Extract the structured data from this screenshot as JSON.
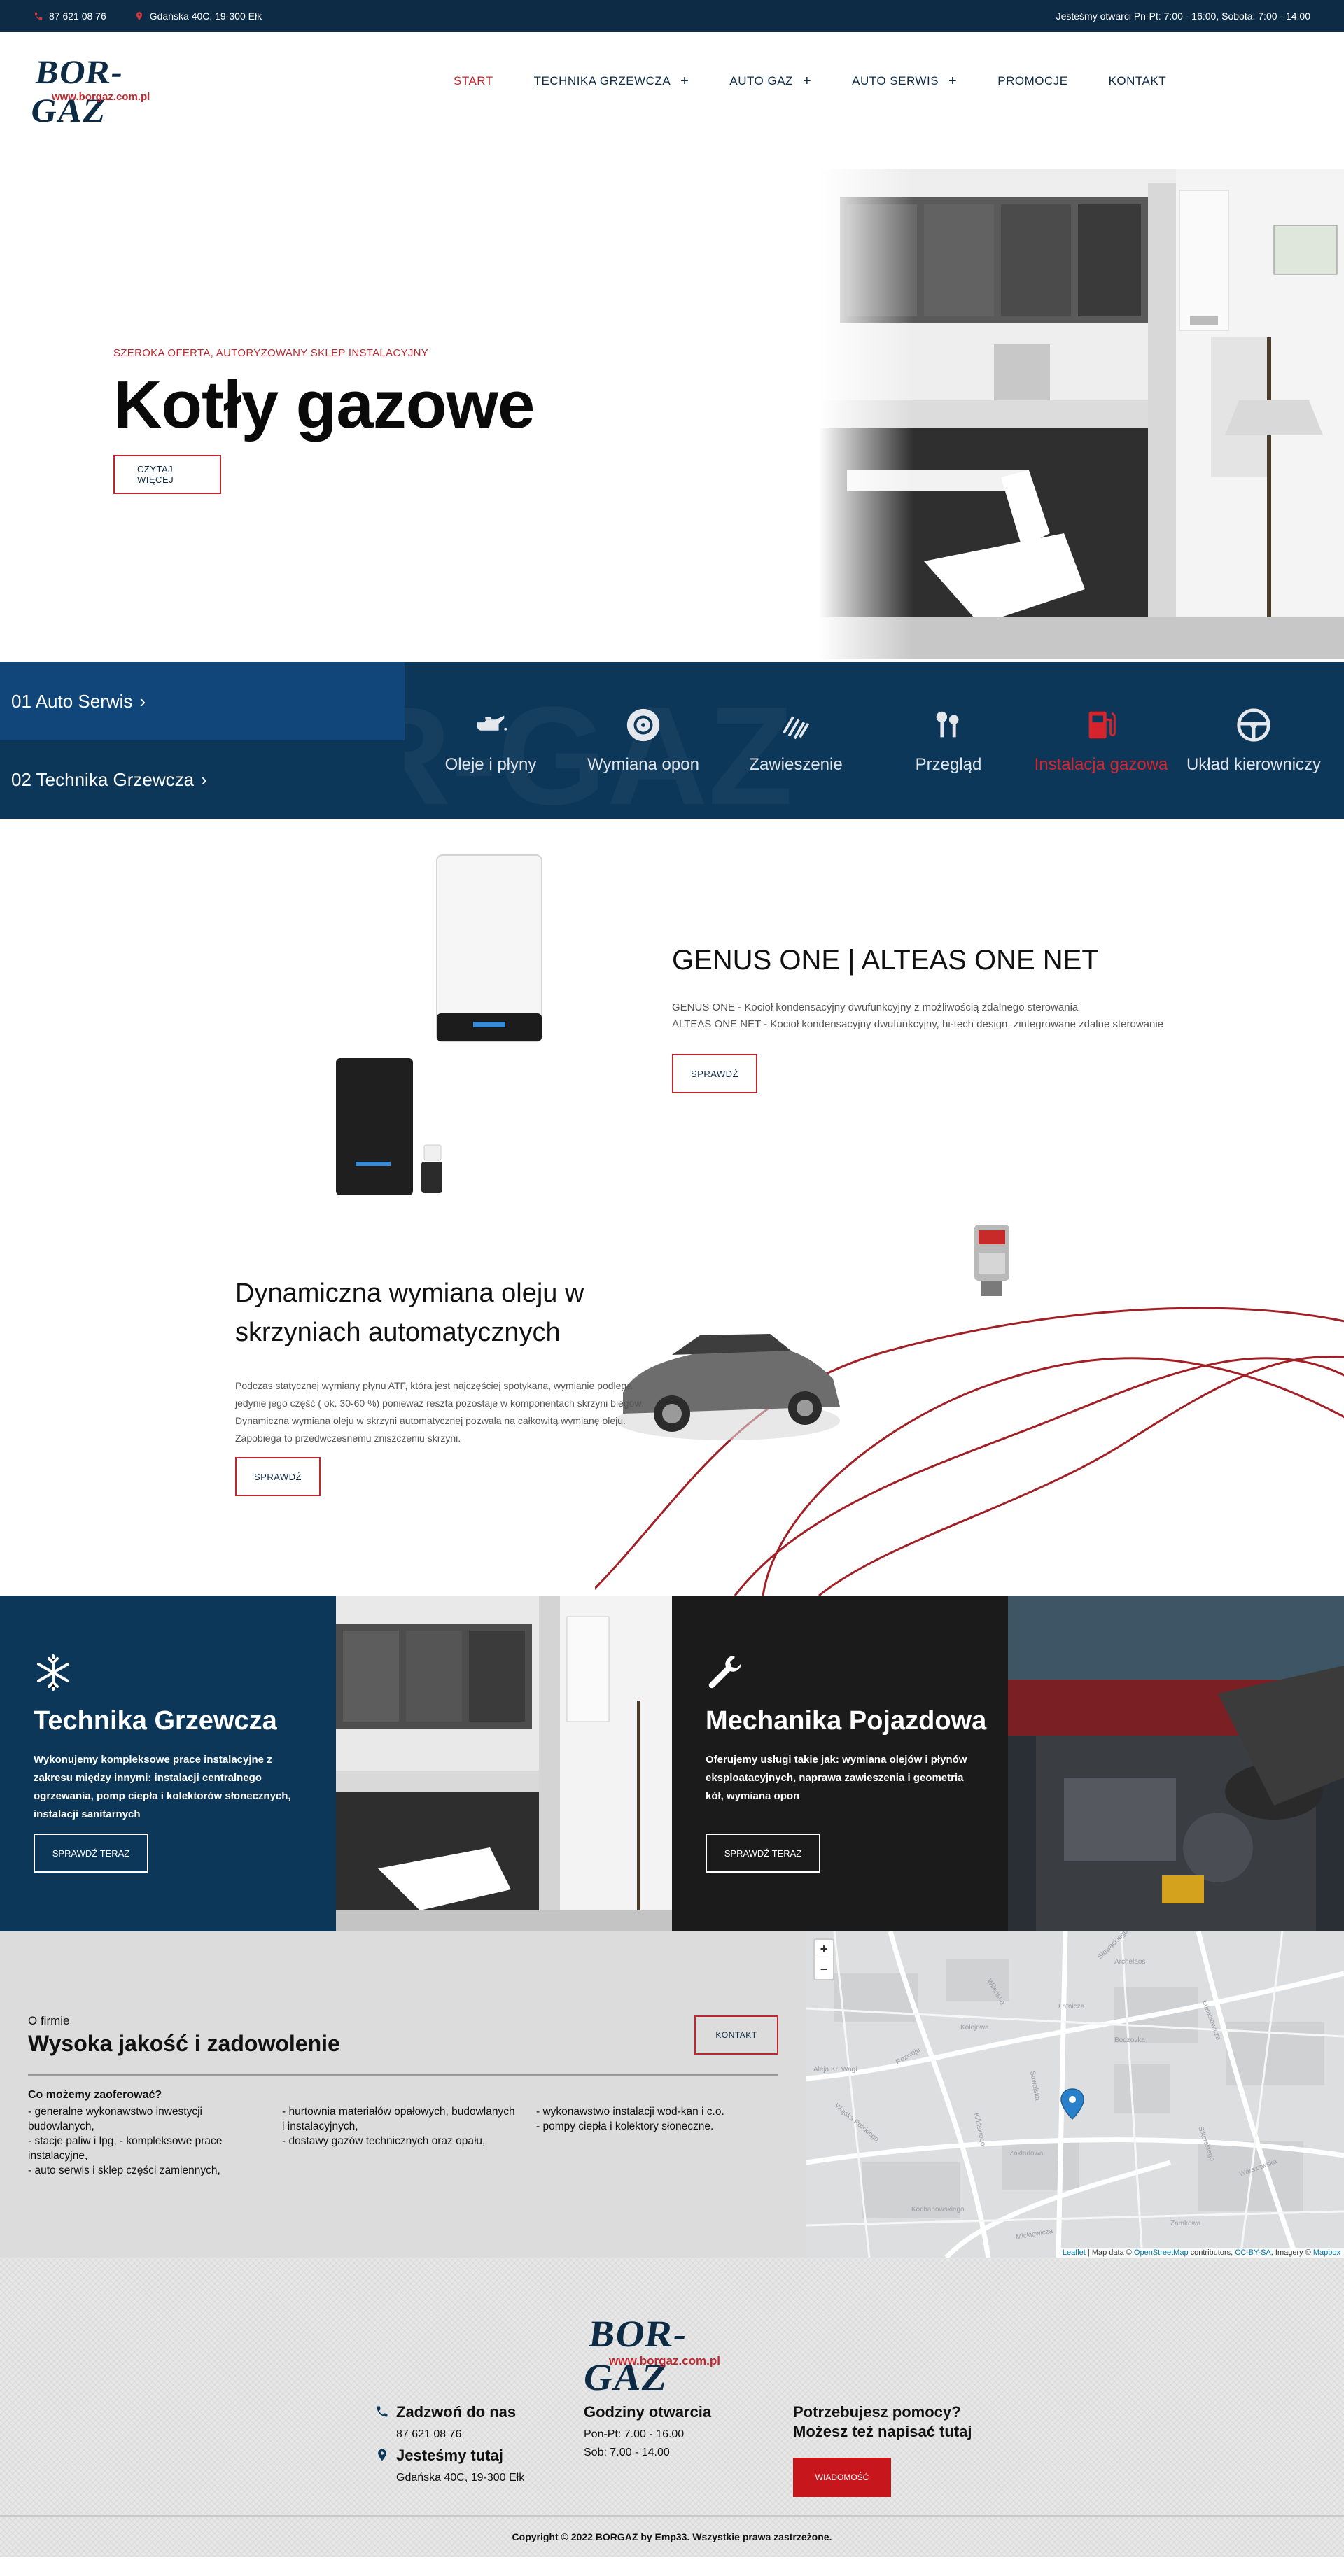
{
  "topbar": {
    "phone": "87 621 08 76",
    "address": "Gdańska 40C, 19-300 Ełk",
    "hours": "Jesteśmy otwarci Pn-Pt: 7:00 - 16:00, Sobota: 7:00 - 14:00"
  },
  "logo": {
    "word": "BOR-GAZ",
    "url": "www.borgaz.com.pl"
  },
  "nav": [
    {
      "label": "START",
      "active": true,
      "has_sub": false
    },
    {
      "label": "TECHNIKA GRZEWCZA",
      "active": false,
      "has_sub": true
    },
    {
      "label": "AUTO GAZ",
      "active": false,
      "has_sub": true
    },
    {
      "label": "AUTO SERWIS",
      "active": false,
      "has_sub": true
    },
    {
      "label": "PROMOCJE",
      "active": false,
      "has_sub": false
    },
    {
      "label": "KONTAKT",
      "active": false,
      "has_sub": false
    }
  ],
  "nav_plus": "+",
  "hero": {
    "overline": "SZEROKA OFERTA, AUTORYZOWANY SKLEP INSTALACYJNY",
    "title": "Kotły gazowe",
    "button": "CZYTAJ WIĘCEJ"
  },
  "service": {
    "tabs": [
      {
        "label": "01 Auto Serwis"
      },
      {
        "label": "02 Technika Grzewcza"
      }
    ],
    "chevron": "›",
    "watermark": "BOR-GAZ",
    "items": [
      {
        "label": "Oleje i płyny",
        "icon": "oil-can-icon"
      },
      {
        "label": "Wymiana opon",
        "icon": "tire-icon"
      },
      {
        "label": "Zawieszenie",
        "icon": "spring-icon"
      },
      {
        "label": "Przegląd",
        "icon": "keys-icon"
      },
      {
        "label": "Instalacja gazowa",
        "icon": "gas-pump-icon"
      },
      {
        "label": "Układ kierowniczy",
        "icon": "steering-wheel-icon"
      }
    ],
    "highlight_color": "#d6242d"
  },
  "product": {
    "title": "GENUS ONE | ALTEAS ONE NET",
    "desc_line1": "GENUS ONE - Kocioł kondensacyjny dwufunkcyjny z możliwością zdalnego sterowania",
    "desc_line2": "ALTEAS ONE NET - Kocioł kondensacyjny dwufunkcyjny, hi-tech design, zintegrowane zdalne sterowanie",
    "button": "SPRAWDŹ"
  },
  "oil": {
    "title": "Dynamiczna wymiana oleju w skrzyniach automatycznych",
    "desc": "Podczas statycznej wymiany płynu ATF, która jest najczęściej spotykana, wymianie podlega jedynie jego część ( ok. 30-60 %) ponieważ reszta pozostaje w komponentach skrzyni biegów. Dynamiczna wymiana oleju w skrzyni automatycznej pozwala na całkowitą wymianę oleju. Zapobiega to przedwczesnemu zniszczeniu skrzyni.",
    "button": "SPRAWDŹ"
  },
  "cards": [
    {
      "icon": "snowflake-icon",
      "title": "Technika Grzewcza",
      "desc": "Wykonujemy kompleksowe prace instalacyjne z zakresu między innymi: instalacji centralnego ogrzewania, pomp ciepła i kolektorów słonecznych, instalacji sanitarnych",
      "button": "SPRAWDŹ TERAZ"
    },
    {
      "icon": "wrench-icon",
      "title": "Mechanika Pojazdowa",
      "desc": "Oferujemy usługi takie jak: wymiana olejów i płynów eksploatacyjnych, naprawa zawieszenia i geometria kół, wymiana opon",
      "button": "SPRAWDŹ TERAZ"
    }
  ],
  "about": {
    "small": "O firmie",
    "title": "Wysoka jakość i zadowolenie",
    "button": "KONTAKT",
    "question": "Co możemy zaoferować?",
    "col1": [
      "- generalne wykonawstwo inwestycji budowlanych,",
      "- stacje paliw i lpg, - kompleksowe prace instalacyjne,",
      "- auto serwis i sklep części zamiennych,"
    ],
    "col2": [
      "- hurtownia materiałów opałowych, budowlanych i instalacyjnych,",
      "- dostawy gazów technicznych oraz opału,"
    ],
    "col3": [
      "- wykonawstwo instalacji wod-kan i c.o.",
      "- pompy ciepła i kolektory słoneczne."
    ]
  },
  "map": {
    "zoom_in": "+",
    "zoom_out": "−",
    "labels": [
      "Archelaos",
      "Wileńska",
      "Bodzovka",
      "Lotnicza",
      "Łukasiewicza",
      "Kolejowa",
      "Suwalska",
      "Kilińskiego",
      "Wojska Polskiego",
      "Aleja Kr. Wagi",
      "Rozwoju",
      "Zakładowa",
      "Mickiewicza",
      "Sikorskiego",
      "Kochanowskiego",
      "Zamkowa",
      "Warszawska",
      "Słowackiego"
    ],
    "attr_leaflet": "Leaflet",
    "attr_sep1": " | Map data © ",
    "attr_osm": "OpenStreetMap",
    "attr_sep2": " contributors, ",
    "attr_cc": "CC-BY-SA",
    "attr_sep3": ", Imagery © ",
    "attr_mapbox": "Mapbox"
  },
  "footer": {
    "call_title": "Zadzwoń do nas",
    "phone": "87 621 08 76",
    "here_title": "Jesteśmy tutaj",
    "address": "Gdańska 40C, 19-300 Ełk",
    "hours_title": "Godziny otwarcia",
    "hours1": "Pon-Pt: 7.00 - 16.00",
    "hours2": "Sob: 7.00 - 14.00",
    "help_title1": "Potrzebujesz pomocy?",
    "help_title2": "Możesz też napisać tutaj",
    "button": "WIADOMOŚĆ",
    "copyright": "Copyright © 2022 BORGAZ by Emp33. Wszystkie prawa zastrzeżone."
  },
  "colors": {
    "navy": "#0d2b45",
    "accent_red": "#c0262d",
    "blue_panel": "#0d3759"
  }
}
